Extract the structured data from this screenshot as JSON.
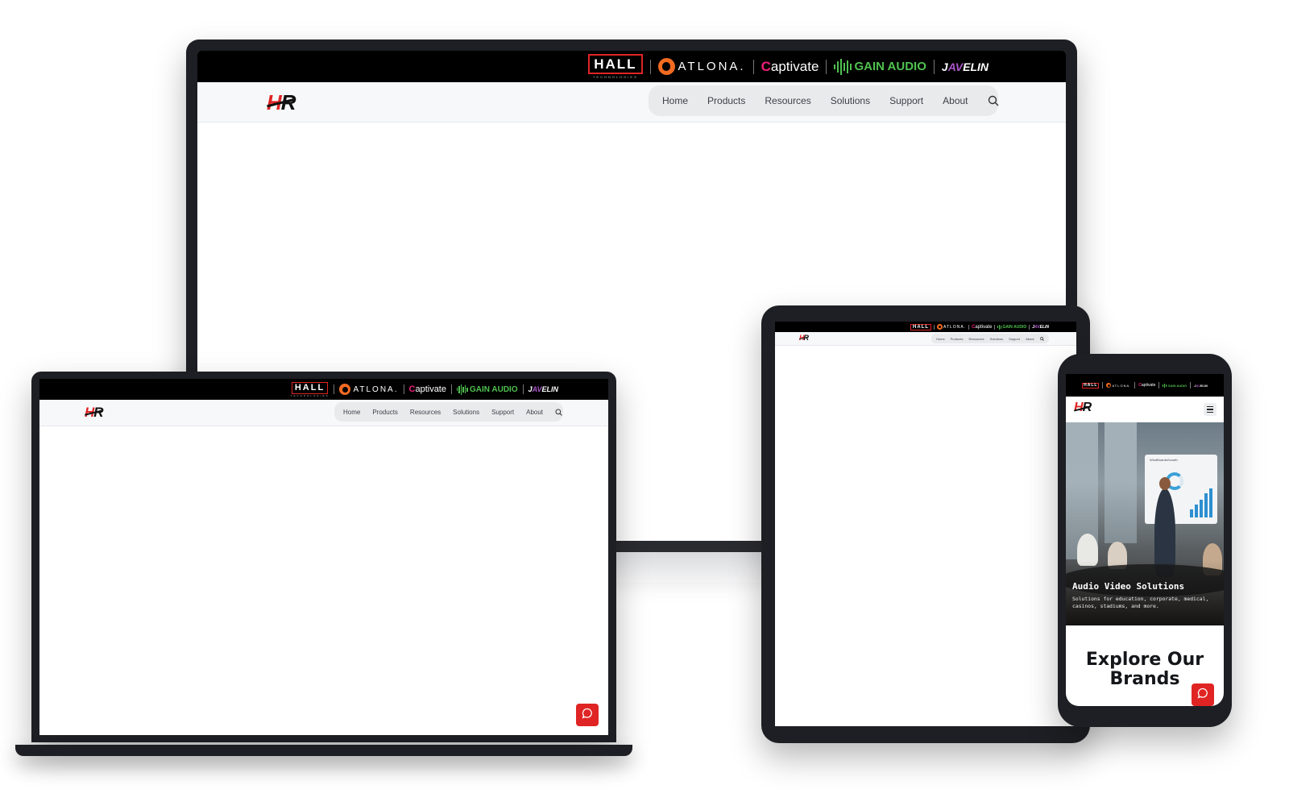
{
  "brands": {
    "hall": "HALL",
    "hall_sub": "TECHNOLOGIES",
    "atlona": "ATLONA.",
    "captivate_c": "C",
    "captivate_rest": "aptivate",
    "gain": "GAIN AUDIO",
    "javelin_j": "J",
    "javelin_a": "AV",
    "javelin_rest": "ELIN"
  },
  "logo": {
    "h": "H",
    "r": "R"
  },
  "nav": {
    "items": [
      "Home",
      "Products",
      "Resources",
      "Solutions",
      "Support",
      "About"
    ]
  },
  "phone": {
    "hero_title": "Audio Video Solutions",
    "hero_subtitle": "Solutions for education, corporate, medical, casinos, stadiums, and more.",
    "board_title": "WindBoardsGrowth",
    "explore": "Explore Our Brands"
  },
  "colors": {
    "accent_red": "#e02424",
    "atlona_orange": "#f36b21",
    "captivate_pink": "#ec1e7a",
    "gain_green": "#4fc14f",
    "javelin_purple": "#a855c7",
    "device_frame": "#1e1f24"
  },
  "icons": {
    "search": "search-icon",
    "chat": "chat-icon",
    "menu": "hamburger-menu-icon"
  }
}
